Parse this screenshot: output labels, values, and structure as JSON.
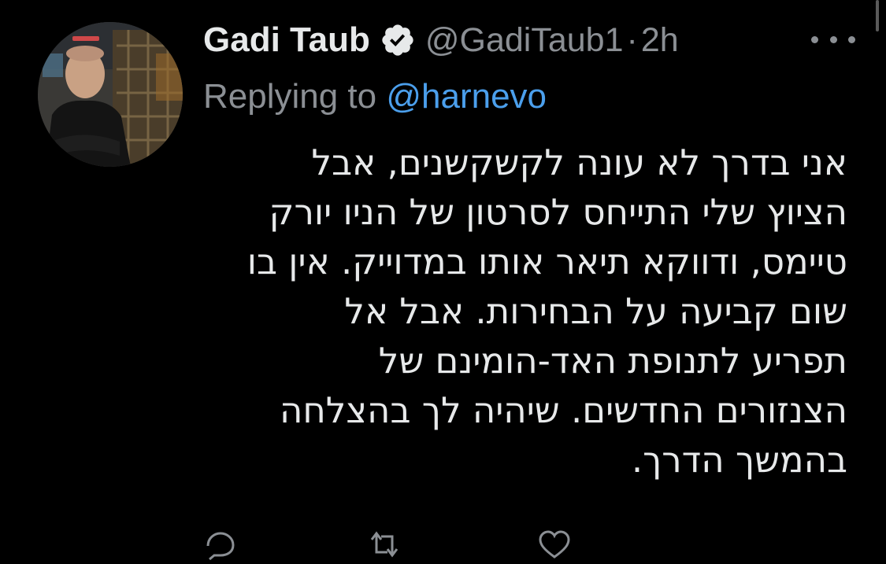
{
  "tweet": {
    "author": {
      "name": "Gadi Taub",
      "handle": "@GadiTaub1",
      "verified": true
    },
    "separator": "·",
    "time": "2h",
    "replying_prefix": "Replying to ",
    "replying_to": "@harnevo",
    "body_lines": [
      "אני בדרך לא עונה לקשקשנים, אבל",
      "הציוץ שלי התייחס לסרטון של הניו יורק",
      "טיימס, ודווקא תיאר אותו במדוייק. אין בו",
      "שום קביעה על הבחירות. אבל אל",
      "תפריע לתנופת האד-הומינם של",
      "הצנזורים החדשים. שיהיה לך בהצלחה",
      "בהמשך הדרך."
    ]
  },
  "icons": {
    "verified": "verified-badge-icon",
    "more": "more-options-icon",
    "reply": "reply-icon",
    "retweet": "retweet-icon",
    "like": "like-icon",
    "share": "share-icon"
  },
  "colors": {
    "background": "#000000",
    "primary_text": "#e7e9ea",
    "secondary_text": "#8b8f94",
    "link": "#4b9fec"
  }
}
